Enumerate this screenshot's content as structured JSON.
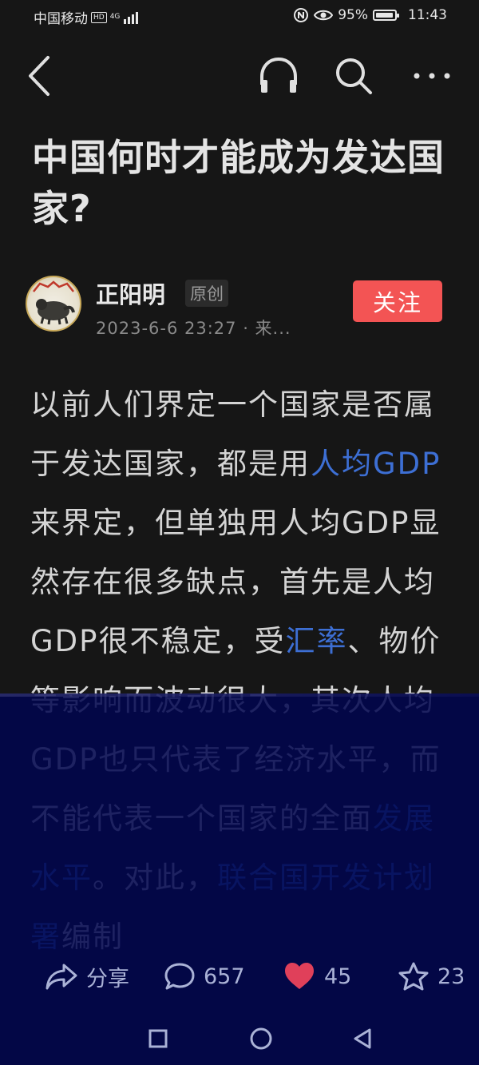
{
  "status_bar": {
    "carrier": "中国移动",
    "hd": "HD",
    "network": "4G",
    "battery_percent": "95%",
    "battery_level": 0.95,
    "time": "11:43"
  },
  "article": {
    "title": "中国何时才能成为发达国家?",
    "body": [
      {
        "text": "以前人们界定一个国家是否属于发达国家，都是用"
      },
      {
        "text": "人均GDP",
        "link": true
      },
      {
        "text": "来界定，但单独用人均GDP显然存在很多缺点，首先是人均GDP很不稳定，受"
      },
      {
        "text": "汇率",
        "link": true
      },
      {
        "text": "、物价等影响而波动很大，其次人均GDP也只代表了经济水平，而不能代表一个国家的全面"
      },
      {
        "text": "发展水平",
        "link": true
      },
      {
        "text": "。对此，"
      },
      {
        "text": "联合国开发计划署",
        "link": true
      },
      {
        "text": "编制"
      }
    ]
  },
  "author": {
    "name": "正阳明",
    "badge": "原创",
    "meta": "2023-6-6 23:27 · 来...",
    "follow_label": "关注"
  },
  "actions": {
    "share_label": "分享",
    "comments": "657",
    "likes": "45",
    "favorites": "23"
  },
  "colors": {
    "background": "#161616",
    "link": "#3d6fd4",
    "follow": "#f35454",
    "like": "#e0405a",
    "overlay": "#00054e"
  },
  "icons": [
    "back-icon",
    "headphones-icon",
    "search-icon",
    "more-icon",
    "share-icon",
    "comment-icon",
    "heart-icon",
    "star-icon",
    "nav-square-icon",
    "nav-circle-icon",
    "nav-back-icon"
  ]
}
